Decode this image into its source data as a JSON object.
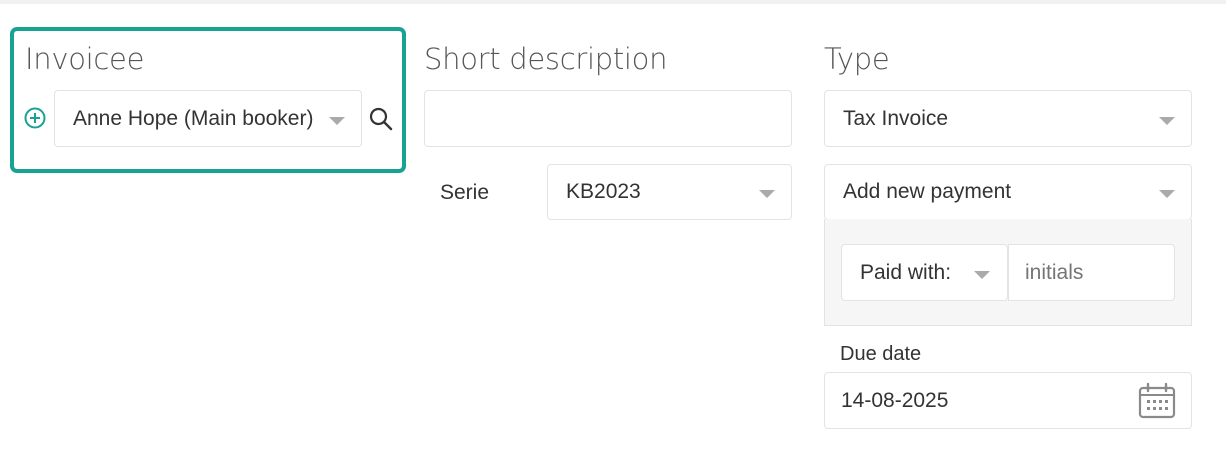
{
  "invoicee": {
    "label": "Invoicee",
    "selected": "Anne Hope (Main booker)",
    "add_icon": "plus-circle-icon",
    "search_icon": "search-icon"
  },
  "short_description": {
    "label": "Short description",
    "value": ""
  },
  "serie": {
    "label": "Serie",
    "selected": "KB2023"
  },
  "type": {
    "label": "Type",
    "selected": "Tax Invoice"
  },
  "payment": {
    "selected": "Add new payment",
    "paid_with_label": "Paid with:",
    "initials_placeholder": "initials"
  },
  "due_date": {
    "label": "Due date",
    "value": "14-08-2025",
    "icon": "calendar-icon"
  },
  "colors": {
    "accent": "#18a293",
    "border": "#e3e3e3",
    "panel_bg": "#f6f6f6"
  }
}
